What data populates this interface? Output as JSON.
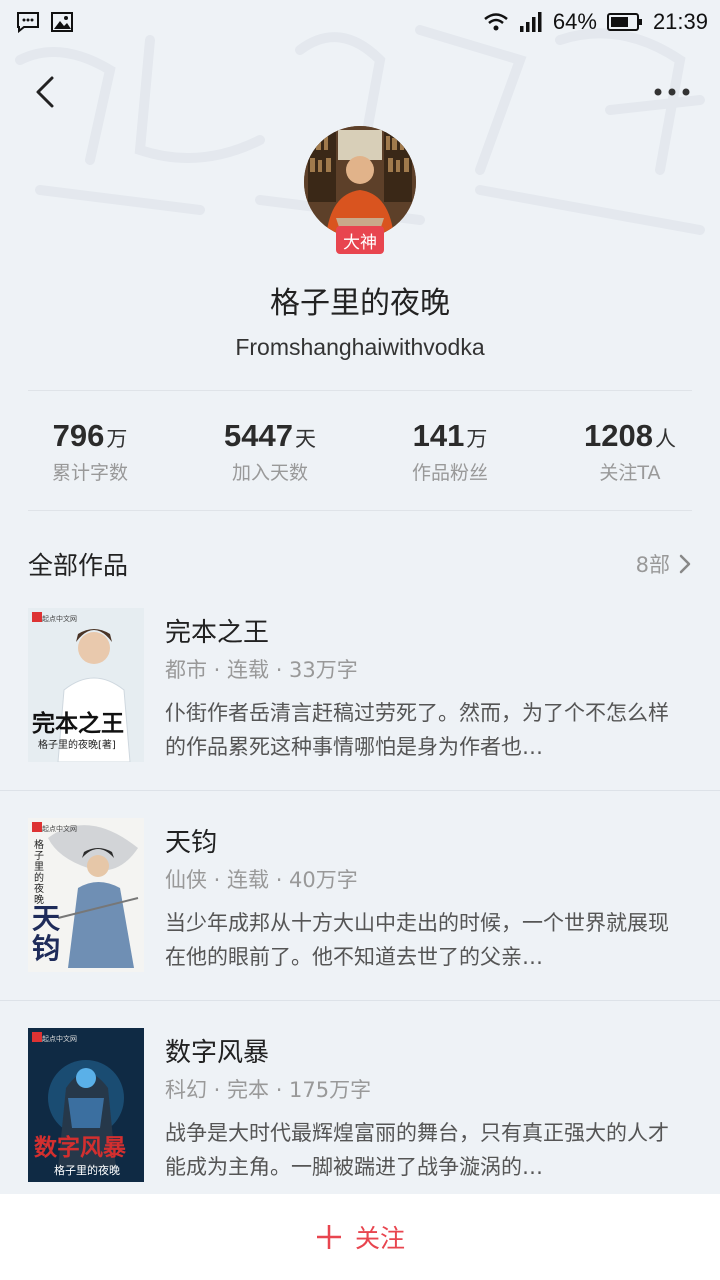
{
  "status": {
    "battery": "64%",
    "time": "21:39"
  },
  "icons": {
    "message": "message-icon",
    "gallery": "image-icon",
    "wifi": "wifi-icon",
    "signal": "signal-icon",
    "battery": "battery-icon",
    "back": "chevron-left-icon",
    "more": "more-dots-icon",
    "plus": "plus-icon",
    "chevron": "chevron-right-icon"
  },
  "profile": {
    "badge": "大神",
    "name": "格子里的夜晚",
    "handle": "Fromshanghaiwithvodka"
  },
  "stats": [
    {
      "num": "796",
      "unit": "万",
      "label": "累计字数"
    },
    {
      "num": "5447",
      "unit": "天",
      "label": "加入天数"
    },
    {
      "num": "141",
      "unit": "万",
      "label": "作品粉丝"
    },
    {
      "num": "1208",
      "unit": "人",
      "label": "关注TA"
    }
  ],
  "works": {
    "title": "全部作品",
    "count": "8部"
  },
  "books": [
    {
      "title": "完本之王",
      "meta": "都市 · 连载 · 33万字",
      "desc": "仆街作者岳清言赶稿过劳死了。然而，为了个不怎么样的作品累死这种事情哪怕是身为作者也…",
      "cover_text": "完本之王",
      "cover_author": "格子里的夜晚[著]",
      "publisher": "起点中文网"
    },
    {
      "title": "天钧",
      "meta": "仙侠 · 连载 · 40万字",
      "desc": "当少年成邦从十方大山中走出的时候，一个世界就展现在他的眼前了。他不知道去世了的父亲…",
      "cover_text": "天钧",
      "cover_author": "格子里的夜晚",
      "publisher": "起点中文网"
    },
    {
      "title": "数字风暴",
      "meta": "科幻 · 完本 · 175万字",
      "desc": "战争是大时代最辉煌富丽的舞台，只有真正强大的人才能成为主角。一脚被踹进了战争漩涡的…",
      "cover_text": "数字风暴",
      "cover_author": "格子里的夜晚",
      "publisher": "起点中文网"
    }
  ],
  "bottom": {
    "follow": "关注"
  },
  "colors": {
    "accent": "#e8454f",
    "background": "#eef2f6"
  }
}
